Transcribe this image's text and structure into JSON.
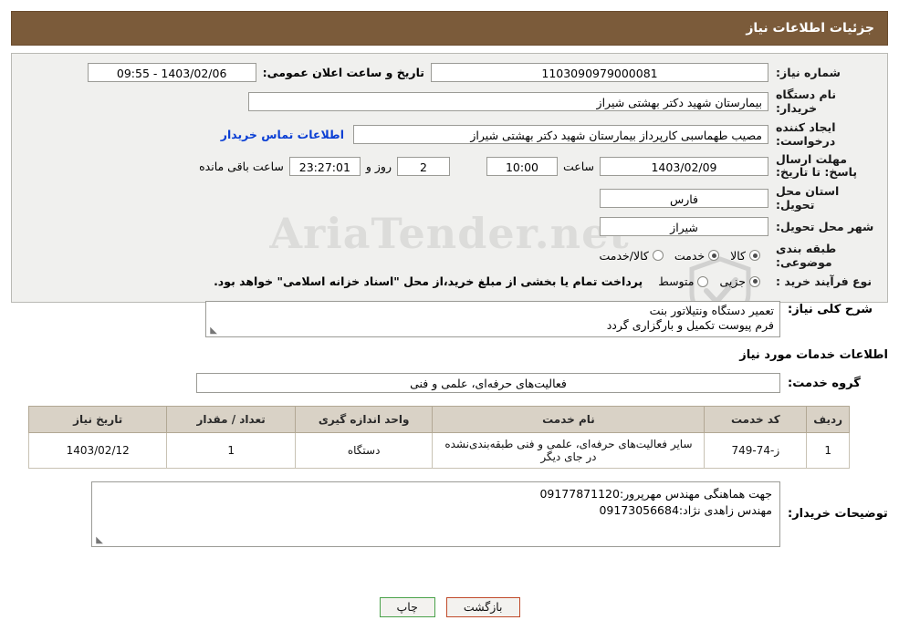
{
  "header": {
    "title": "جزئیات اطلاعات نیاز"
  },
  "form": {
    "need_number_label": "شماره نیاز:",
    "need_number_value": "1103090979000081",
    "announce_datetime_label": "تاریخ و ساعت اعلان عمومی:",
    "announce_datetime_value": "1403/02/06 - 09:55",
    "buyer_org_label": "نام دستگاه خریدار:",
    "buyer_org_value": "بیمارستان شهید دکتر بهشتی شیراز",
    "requester_label": "ایجاد کننده درخواست:",
    "requester_value": "مصیب طهماسبی کارپرداز بیمارستان شهید دکتر بهشتی شیراز",
    "contact_link": "اطلاعات تماس خریدار",
    "deadline_label": "مهلت ارسال پاسخ: تا تاریخ:",
    "deadline_date": "1403/02/09",
    "hour_label": "ساعت",
    "deadline_time": "10:00",
    "days_value": "2",
    "days_label": "روز و",
    "remaining_time": "23:27:01",
    "remaining_label": "ساعت باقی مانده",
    "province_label": "استان محل تحویل:",
    "province_value": "فارس",
    "city_label": "شهر محل تحویل:",
    "city_value": "شیراز",
    "category_label": "طبقه بندی موضوعی:",
    "category_options": [
      {
        "label": "کالا",
        "selected": true
      },
      {
        "label": "خدمت",
        "selected": true
      },
      {
        "label": "کالا/خدمت",
        "selected": false
      }
    ],
    "process_label": "نوع فرآیند خرید :",
    "process_options": [
      {
        "label": "جزیی",
        "selected": true
      },
      {
        "label": "متوسط",
        "selected": false
      }
    ],
    "payment_note": "پرداخت تمام یا بخشی از مبلغ خرید،از محل \"اسناد خزانه اسلامی\" خواهد بود."
  },
  "need_summary": {
    "label": "شرح کلی نیاز:",
    "lines": [
      "تعمیر دستگاه ونتیلاتور بنت",
      "فرم پیوست تکمیل و بارگزاری گردد"
    ]
  },
  "services_section": {
    "title": "اطلاعات خدمات مورد نیاز",
    "group_label": "گروه خدمت:",
    "group_value": "فعالیت‌های حرفه‌ای، علمی و فنی",
    "columns": [
      "ردیف",
      "کد خدمت",
      "نام خدمت",
      "واحد اندازه گیری",
      "تعداد / مقدار",
      "تاریخ نیاز"
    ],
    "rows": [
      {
        "radif": "1",
        "code": "ز-74-749",
        "name": "سایر فعالیت‌های حرفه‌ای، علمی و فنی طبقه‌بندی‌نشده در جای دیگر",
        "unit": "دستگاه",
        "count": "1",
        "date": "1403/02/12"
      }
    ]
  },
  "buyer_notes": {
    "label": "توضیحات خریدار:",
    "lines": [
      "جهت هماهنگی مهندس مهرپرور:09177871120",
      "مهندس زاهدی نژاد:09173056684"
    ]
  },
  "buttons": {
    "print": "چاپ",
    "back": "بازگشت"
  },
  "watermark": {
    "text": "AriaTender.net"
  },
  "colors": {
    "header_bg": "#7b5b3a",
    "link": "#0b3fd4",
    "table_header_bg": "#d9d2c6",
    "panel_bg": "#f0f0ee"
  }
}
